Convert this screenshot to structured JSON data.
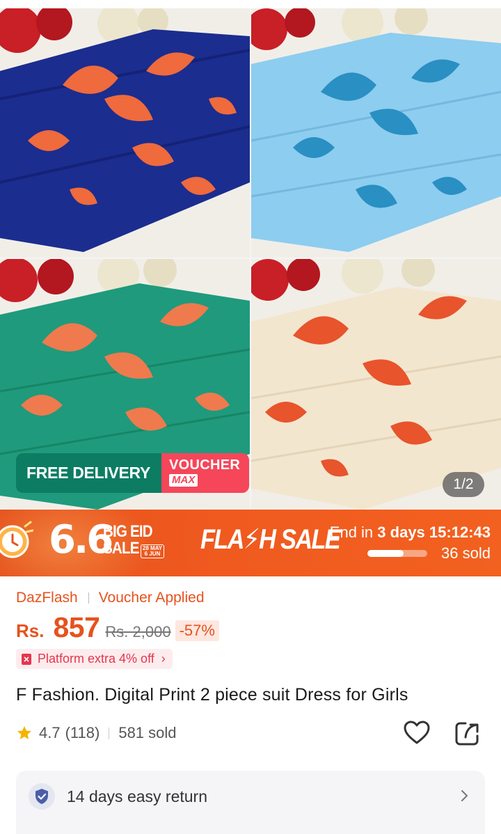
{
  "gallery": {
    "free_delivery_label": "FREE DELIVERY",
    "voucher_label": "VOUCHER",
    "voucher_max_label": "MAX",
    "pager": "1/2",
    "fabric_colors": [
      "#1b2d8f",
      "#7fc3e8",
      "#1f9a7c",
      "#f3e6cf"
    ],
    "print_color": "#ef6a3c"
  },
  "flash_banner": {
    "event_number": "6.6",
    "event_line1": "BIG EID",
    "event_line2": "SALE",
    "event_dates_line1": "28 MAY",
    "event_dates_line2": "6 JUN",
    "flash_sale_label": "FLA⚡H SALE",
    "end_prefix": "End in",
    "end_days": "3 days",
    "countdown": "15:12:43",
    "sold_label": "36 sold",
    "sold_progress": 0.6
  },
  "price": {
    "tag_dazflash": "DazFlash",
    "tag_voucher": "Voucher Applied",
    "currency": "Rs.",
    "current": "857",
    "original": "Rs. 2,000",
    "discount": "-57%",
    "platform_offer": "Platform extra 4% off"
  },
  "product": {
    "title": "F Fashion. Digital Print 2 piece suit Dress for Girls",
    "rating": "4.7",
    "reviews": "(118)",
    "sold": "581 sold"
  },
  "return_policy": {
    "label": "14 days easy return"
  },
  "colors": {
    "accent_orange": "#e6521e",
    "badge_green": "#0c7c63",
    "badge_red": "#f5465a",
    "star_yellow": "#f4b400"
  }
}
